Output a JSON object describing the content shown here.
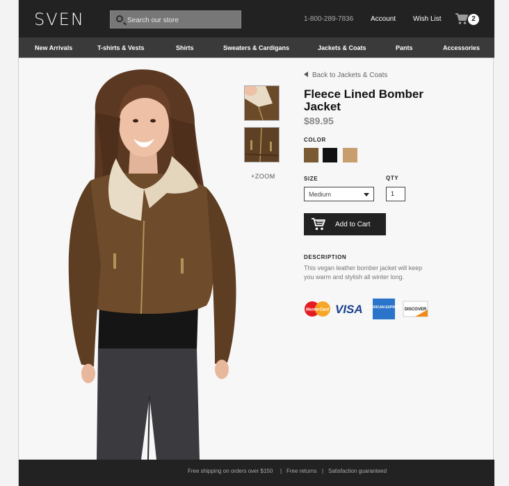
{
  "header": {
    "logo": "SVEN",
    "search_placeholder": "Search our store",
    "phone": "1-800-289-7836",
    "account_label": "Account",
    "wishlist_label": "Wish List",
    "cart_count": "2"
  },
  "nav": {
    "items": [
      "New Arrivals",
      "T-shirts & Vests",
      "Shirts",
      "Sweaters & Cardigans",
      "Jackets & Coats",
      "Pants",
      "Accessories"
    ]
  },
  "product": {
    "back_link": "Back to Jackets & Coats",
    "title": "Fleece Lined Bomber Jacket",
    "price": "$89.95",
    "zoom_label": "+ZOOM",
    "color_label": "COLOR",
    "colors": [
      "#7a5a33",
      "#111111",
      "#c99e6f"
    ],
    "size_label": "SIZE",
    "size_value": "Medium",
    "qty_label": "QTY",
    "qty_value": "1",
    "add_to_cart": "Add to Cart",
    "description_label": "DESCRIPTION",
    "description": "This vegan leather bomber jacket will keep you warm and stylish all winter long.",
    "payment_icons": [
      "mastercard-icon",
      "visa-icon",
      "american-express-icon",
      "discover-icon"
    ],
    "payment_text": {
      "mastercard": "MasterCard",
      "visa": "VISA",
      "amex": "AMERICAN EXPRESS",
      "discover": "DISCOVER"
    }
  },
  "footer": {
    "shipping": "Free shipping on orders over $150",
    "returns": "Free returns",
    "satisfaction": "Satisfaction guaranteed"
  }
}
